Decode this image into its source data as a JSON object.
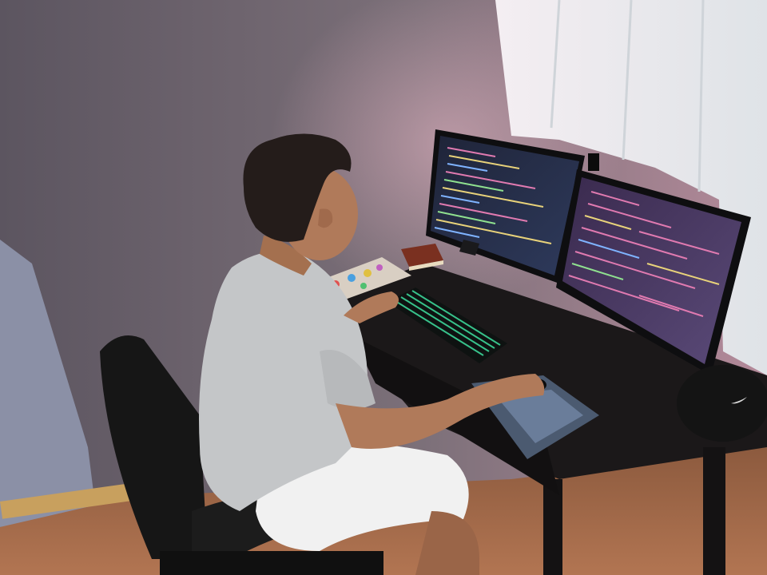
{
  "scene": {
    "description": "",
    "colors": {
      "wall": "#7a6f78",
      "curtain": "#e9ecef",
      "floor": "#a0684a",
      "desk": "#1a1718",
      "shirt": "#c4c6c8",
      "shorts": "#f1f1f1",
      "skin": "#b07a5a",
      "hair": "#241c1a",
      "chair": "#151515",
      "monitor_bezel": "#0e0e10",
      "screen_left": "#2b3550",
      "screen_right": "#3a2c4a",
      "keyboard_glow": "#3fe0a0",
      "code_pink": "#e07ab0",
      "code_yellow": "#e8d27a",
      "code_blue": "#7fb3ff",
      "code_green": "#8fe08f"
    }
  }
}
